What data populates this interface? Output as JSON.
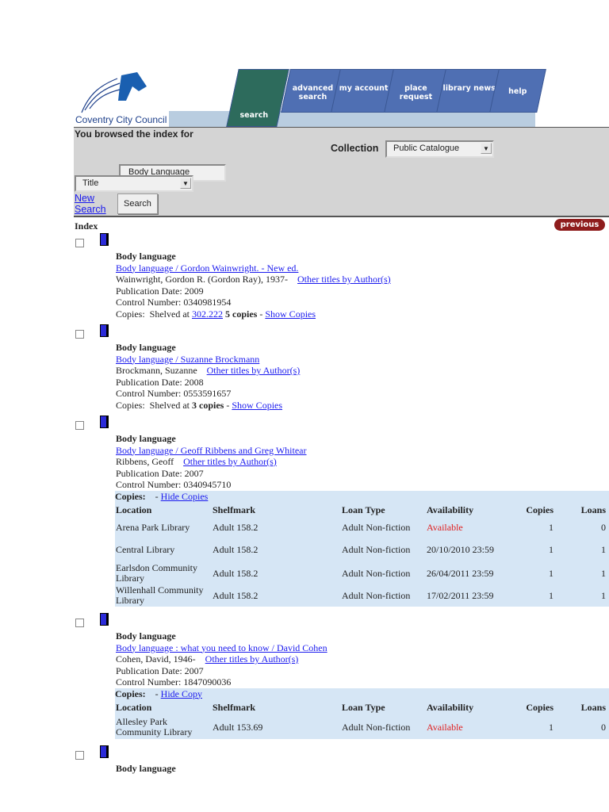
{
  "header": {
    "logo_text": "Coventry City Council",
    "tabs": [
      {
        "label": "search"
      },
      {
        "label": "advanced search"
      },
      {
        "label": "my account"
      },
      {
        "label": "place request"
      },
      {
        "label": "library news"
      },
      {
        "label": "help"
      }
    ]
  },
  "search": {
    "heading": "You browsed the index for",
    "collection_label": "Collection",
    "collection_value": "Public Catalogue",
    "term": "Body Language",
    "index_value": "Title",
    "new_search": "New Search",
    "search_button": "Search"
  },
  "results": {
    "index_label": "Index",
    "previous_button": "previous",
    "records": [
      {
        "title": "Body language",
        "link": "Body language / Gordon Wainwright. - New ed.",
        "author": "Wainwright, Gordon R. (Gordon Ray), 1937-",
        "other": "Other titles by Author(s)",
        "pubdate": "Publication Date: 2009",
        "control": "Control Number: 0340981954",
        "copies_prefix": "Copies:  Shelved at ",
        "shelf_link": "302.222",
        "copies_count": "5 copies",
        "toggle": "Show Copies"
      },
      {
        "title": "Body language",
        "link": "Body language / Suzanne Brockmann",
        "author": "Brockmann, Suzanne",
        "other": "Other titles by Author(s)",
        "pubdate": "Publication Date: 2008",
        "control": "Control Number: 0553591657",
        "copies_prefix": "Copies:  Shelved at ",
        "copies_count": "3 copies",
        "toggle": "Show Copies"
      },
      {
        "title": "Body language",
        "link": "Body language / Geoff Ribbens and Greg Whitear",
        "author": "Ribbens, Geoff",
        "other": "Other titles by Author(s)",
        "pubdate": "Publication Date: 2007",
        "control": "Control Number: 0340945710",
        "copies_label": "Copies:",
        "toggle": "Hide Copies",
        "columns": [
          "Location",
          "Shelfmark",
          "Loan Type",
          "Availability",
          "Copies",
          "Loans"
        ],
        "rows": [
          [
            "Arena Park Library",
            "Adult 158.2",
            "Adult Non-fiction",
            "Available",
            "1",
            "0"
          ],
          [
            "Central Library",
            "Adult 158.2",
            "Adult Non-fiction",
            "20/10/2010 23:59",
            "1",
            "1"
          ],
          [
            "Earlsdon Community Library",
            "Adult 158.2",
            "Adult Non-fiction",
            "26/04/2011 23:59",
            "1",
            "1"
          ],
          [
            "Willenhall Community Library",
            "Adult 158.2",
            "Adult Non-fiction",
            "17/02/2011 23:59",
            "1",
            "1"
          ]
        ]
      },
      {
        "title": "Body language",
        "link": "Body language : what you need to know / David Cohen",
        "author": "Cohen, David, 1946-",
        "other": "Other titles by Author(s)",
        "pubdate": "Publication Date: 2007",
        "control": "Control Number: 1847090036",
        "copies_label": "Copies:",
        "toggle": "Hide Copy",
        "columns": [
          "Location",
          "Shelfmark",
          "Loan Type",
          "Availability",
          "Copies",
          "Loans"
        ],
        "rows": [
          [
            "Allesley Park Community Library",
            "Adult 153.69",
            "Adult Non-fiction",
            "Available",
            "1",
            "0"
          ]
        ]
      },
      {
        "title": "Body language"
      }
    ]
  },
  "colors": {
    "tab": "#4f6fb3",
    "active_tab": "#2d6b5c",
    "copies_bg": "#d6e6f5",
    "available": "#e02020"
  }
}
